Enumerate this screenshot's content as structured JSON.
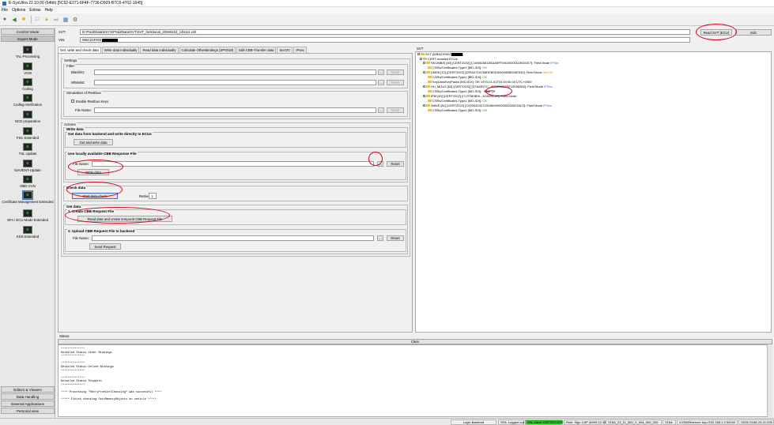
{
  "window": {
    "title": "E-SysUltra 22.10.00 (64bit) [5C52-E371-6F4F-7736-D509-B7C6-4702-1645]"
  },
  "menu": [
    "File",
    "Options",
    "Extras",
    "Help"
  ],
  "sidebar": {
    "top_tabs": [
      "Comfort Mode",
      "Expert Mode"
    ],
    "items": [
      "TAL-Processing",
      "VCM",
      "Coding",
      "Coding-Verification",
      "NCD preparation",
      "FSC Extended",
      "TSL Update",
      "NAV/ENT-Update",
      "OBD-CVN",
      "Certificate Management Extended",
      "SFA / ECU-Mode Extended",
      "KDS Extended"
    ],
    "bottom_tabs": [
      "Editors & Viewers",
      "Data Handling",
      "External Applications",
      "Personal view"
    ]
  },
  "svt_row": {
    "label": "SVT:",
    "path": "D:\\PSdZData\\ESYS\\PSdZData\\SVT\\SVT_funktional_20260410_145111.xml",
    "read_button": "Read SVT (ECU)",
    "edit_button": "Edit"
  },
  "vin_row": {
    "label": "VIN:",
    "value": "WBA23F603"
  },
  "tabs": [
    "Get, write and check data",
    "Write data individually",
    "Read data individually",
    "Calculate OtherBindings (SP2018)",
    "Edit CBB-Transfer data",
    "SecOC",
    "IPsec"
  ],
  "settings": {
    "title": "Settings",
    "filter_title": "Filter",
    "blacklist_label": "Blacklist:",
    "whitelist_label": "Whitelist:",
    "simulation_title": "Simulation of Restbus",
    "enable_restbus_label": "Enable Restbus Keys",
    "file_name_label": "File Name:",
    "browse": "...",
    "reset": "Reset"
  },
  "actions": {
    "title": "Actions",
    "write_data_title": "Write data",
    "get_from_backend_title": "Get data from backend and write directly to ECUs",
    "get_and_write_button": "Get and write data",
    "use_local_title": "Use locally available CBB Response File",
    "file_name_label": "File Name:",
    "write_data_button": "Write data",
    "reset": "Reset",
    "browse": "...",
    "check_data_title": "Check data",
    "start_check_button": "Start data check",
    "retries_label": "Retries:",
    "retries_value": "1",
    "get_data_title": "Get data",
    "create_request_title": "1. Create CBB Request File",
    "read_create_button": "Read data and create temporal CBB Request File",
    "upload_title": "2. Upload CBB Request File to backend",
    "send_request_button": "Send Request"
  },
  "tree": {
    "header": "SVT",
    "root": "SVT [WBA23F603",
    "group": "CERT-enabled ECUs",
    "nodes": [
      {
        "ecu": "SKOMBIS [60] [CERT2022] [C1650D5818SAA9FF000000001DE601E7]: Field Mode",
        "mode": "IPSec",
        "child": "CSRs/Certificates Type1 [MO-IDX]:",
        "status": "OK"
      },
      {
        "ecu": "DME8 [12] [CERT2022] [33FAA7ZA768DEB91000000BB016E532]: Field Mode",
        "mode": "SecOC",
        "child": "CSRs/Certificates Type1 [MO-IDX]:",
        "status": "OK",
        "extra": "KeyLists/KeyPacks [MO-IDX]: OK 1970-01-01T03:00:00.00 UTC+0300"
      },
      {
        "ecu": "HU_MGU2 [63] [CERT2022] [D7A6E57C...8DBE62E6EE19008300]: Field Mode",
        "mode": "IPSec",
        "child": "CSRs/Certificates Type1 [MO-IDX]:",
        "status": "EMPTY"
      },
      {
        "ecu": "IPM [40] [CERT2022] [C17F5E8E6...3C8D5C2F]: Field Mode",
        "mode": "",
        "child": "CSRs/Certificates Type1 [MO-IDX]:",
        "status": "OK"
      },
      {
        "ecu": "WAVE [61] [CERT2022] [C0000324271D0A6000000000426216C2]: Field Mode",
        "mode": "IPSec",
        "child": "CSRs/Certificates Type1 [MO-IDX]:",
        "status": "OK"
      }
    ]
  },
  "status_panel": {
    "title": "Status:",
    "clear_button": "Clear",
    "lines": [
      "**************",
      "Detailed Status Other Bindings",
      "**************",
      "",
      "**************",
      "Detailed Status Online Bindings",
      "**************",
      "",
      "**************",
      "Detailed Status Snippets",
      "**************",
      "",
      "**** Processing \"RetryFreeCertChecking\" was successful ****",
      "",
      "***** Finish checking CertMemoryObjects on vehicle *****"
    ]
  },
  "statusbar": {
    "login_backend": "Login Backend",
    "sfa": "SFA: Logged out",
    "sw": "SW_Gen2 CERTIFICATE",
    "role": "Role: Sign CAP (9999-12-31)",
    "s18a": "S18A_23_11_560_V_004_000_000",
    "s18a_short": "S18A",
    "conn": "ICOM/Ethernet: tcp://192.168.1.2:50160",
    "g026": "G026,S18A-24-11-530"
  },
  "colors": {
    "annotation": "#d2001a",
    "ok": "#1a9a1a",
    "warn": "#d08000"
  }
}
